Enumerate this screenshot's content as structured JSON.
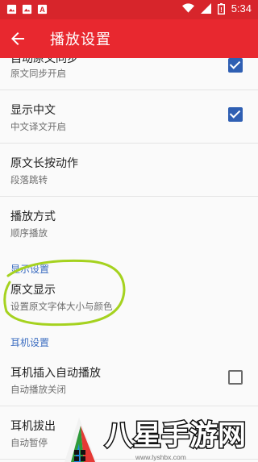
{
  "status_bar": {
    "time": "5:34",
    "icons": [
      "image-icon",
      "image-icon",
      "text-icon",
      "wifi-icon",
      "signal-icon",
      "battery-icon"
    ]
  },
  "app_bar": {
    "title": "播放设置",
    "back_icon": "arrow-left-icon"
  },
  "settings": {
    "sync": {
      "title": "自动原文同步",
      "summary": "原文同步开启",
      "checked": true
    },
    "show_chinese": {
      "title": "显示中文",
      "summary": "中文译文开启",
      "checked": true
    },
    "long_press": {
      "title": "原文长按动作",
      "summary": "段落跳转"
    },
    "play_mode": {
      "title": "播放方式",
      "summary": "顺序播放"
    },
    "display_section": "显示设置",
    "text_display": {
      "title": "原文显示",
      "summary": "设置原文字体大小与颜色"
    },
    "earphone_section": "耳机设置",
    "insert_autoplay": {
      "title": "耳机插入自动播放",
      "summary": "自动播放关闭",
      "checked": false
    },
    "unplug": {
      "title": "耳机拔出",
      "summary": "自动暂停"
    }
  },
  "watermark": {
    "text": "八星手游网",
    "url": "www.lyshbx.com"
  },
  "colors": {
    "app_bar": "#e8282f",
    "status_bar": "#d7252b",
    "accent": "#2f5fb3",
    "section_header": "#3b6cc0",
    "annotation": "#a5d21f"
  }
}
